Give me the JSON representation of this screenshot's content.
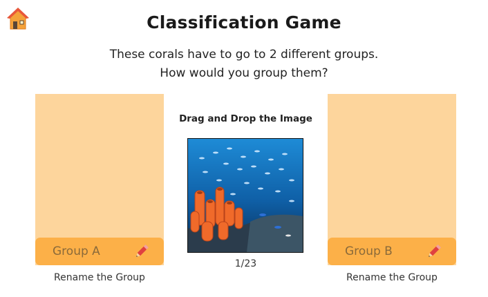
{
  "header": {
    "home_icon": "home-icon",
    "title": "Classification Game",
    "subtitle_line1": "These corals have to go to 2 different groups.",
    "subtitle_line2": "How would you group them?"
  },
  "groups": [
    {
      "name": "Group A",
      "rename_label": "Rename the Group",
      "edit_icon": "pencil-icon"
    },
    {
      "name": "Group B",
      "rename_label": "Rename the Group",
      "edit_icon": "pencil-icon"
    }
  ],
  "center": {
    "instruction": "Drag and Drop the Image",
    "image_subject": "coral reef with orange sponge corals and a school of fish",
    "counter": "1/23"
  },
  "colors": {
    "group_zone": "#fdd59c",
    "group_bar": "#fcb048",
    "group_text": "#8a6a3a"
  }
}
